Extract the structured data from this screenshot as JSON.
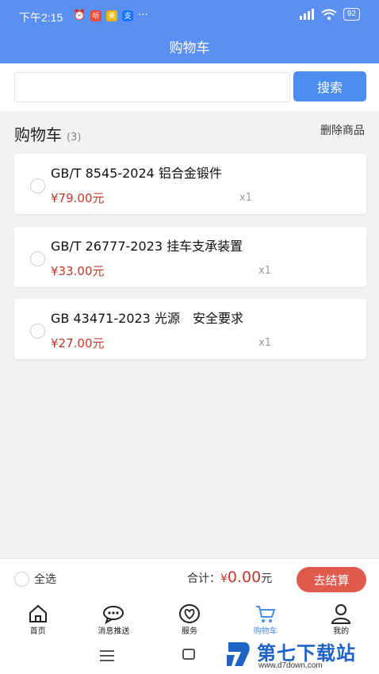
{
  "status_bar": {
    "time": "下午2:15",
    "battery": "92",
    "badge1": "听",
    "badge2": "美",
    "badge3": "支",
    "dots": "···"
  },
  "header": {
    "title": "购物车"
  },
  "search": {
    "placeholder": "",
    "button_label": "搜索"
  },
  "cart": {
    "title": "购物车",
    "count": "(3)",
    "delete_label": "删除商品",
    "items": [
      {
        "name": "GB/T 8545-2024 铝合金锻件",
        "price": "¥79.00元",
        "qty": "x1"
      },
      {
        "name": "GB/T 26777-2023 挂车支承装置",
        "price": "¥33.00元",
        "qty": "x1"
      },
      {
        "name": "GB 43471-2023 光源　安全要求",
        "price": "¥27.00元",
        "qty": "x1"
      }
    ]
  },
  "checkout": {
    "select_all": "全选",
    "total_label": "合计：",
    "currency": "¥",
    "total_amount": "0.00",
    "unit": "元",
    "button_label": "去结算"
  },
  "tabs": [
    {
      "label": "首页",
      "icon": "home-icon"
    },
    {
      "label": "消息推送",
      "icon": "message-icon"
    },
    {
      "label": "服务",
      "icon": "heart-icon"
    },
    {
      "label": "购物车",
      "icon": "cart-icon",
      "active": true
    },
    {
      "label": "我的",
      "icon": "user-icon"
    }
  ],
  "watermark": {
    "title": "第七下载站",
    "url": "www.d7down.com"
  },
  "colors": {
    "header": "#5b8ff2",
    "accent": "#4a8cf0",
    "price": "#c0392b",
    "checkout_button": "#e05a4e"
  }
}
